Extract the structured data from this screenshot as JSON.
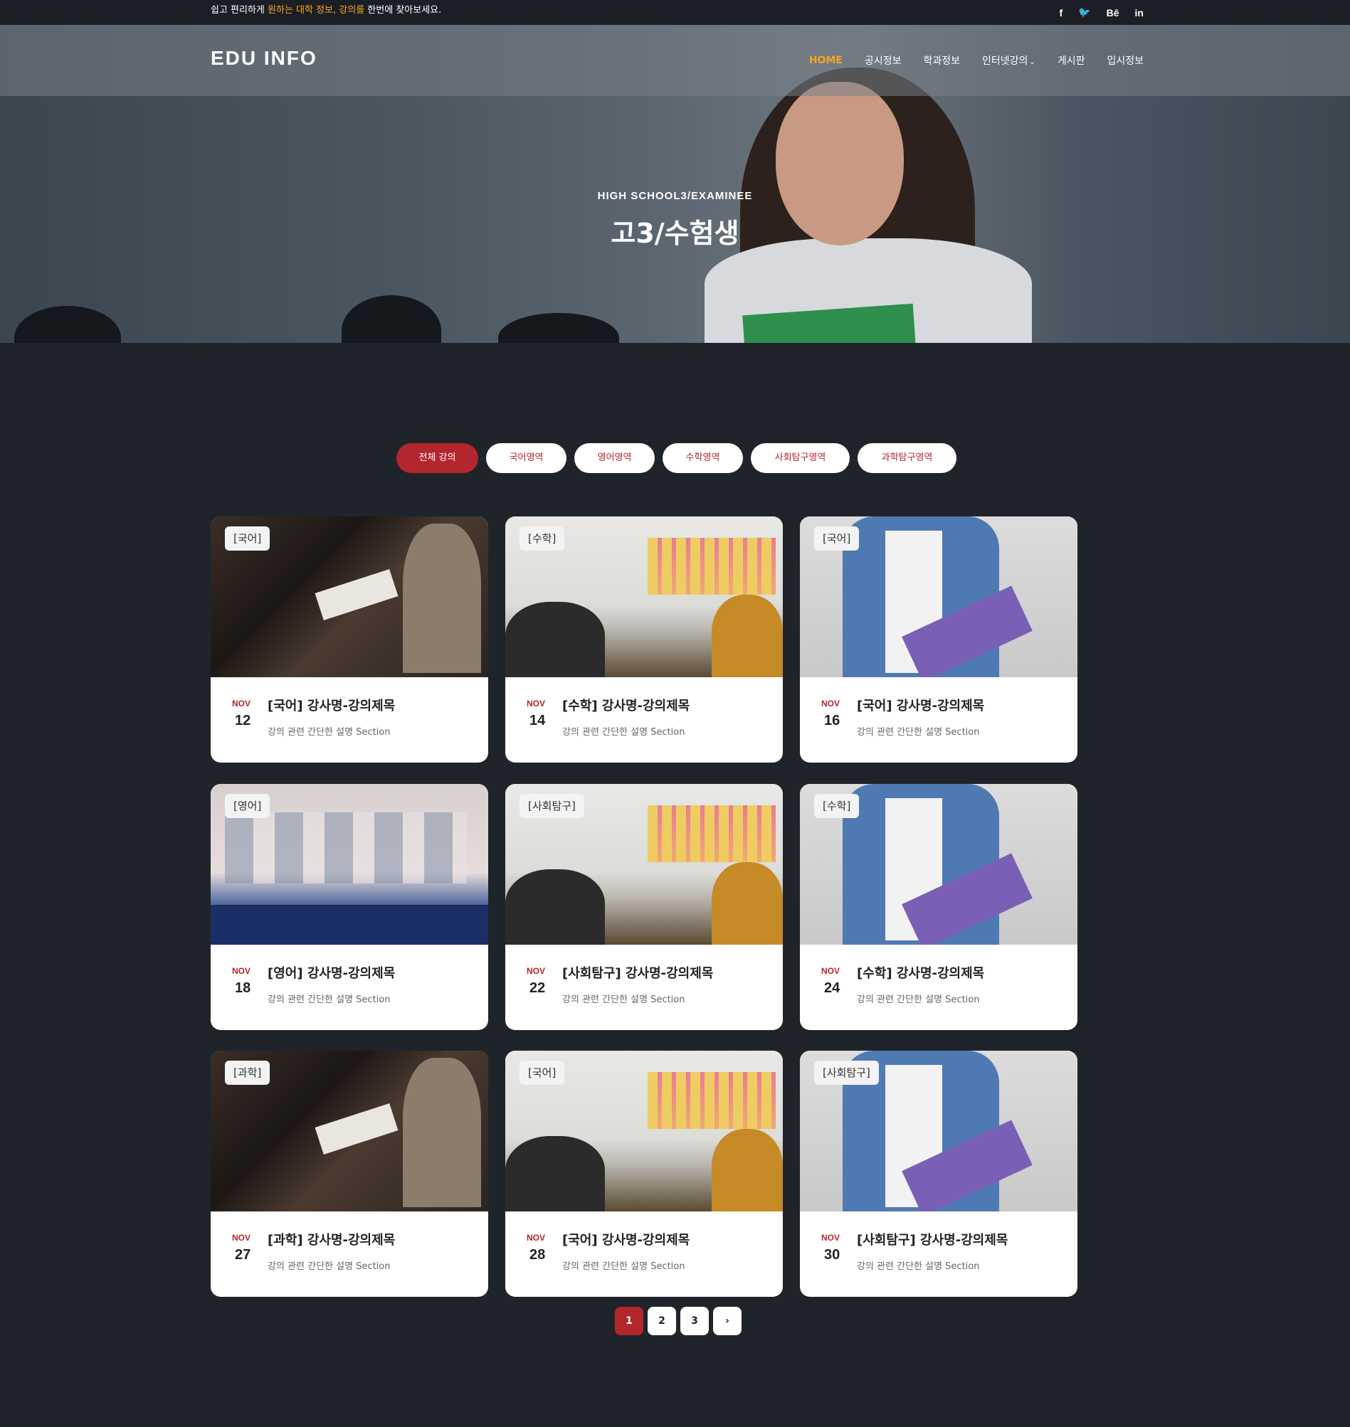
{
  "topbar": {
    "message_pre": "쉽고 편리하게 ",
    "message_hl": "원하는 대학 정보, 강의를",
    "message_post": " 한번에 찾아보세요.",
    "social": [
      "f",
      "🐦",
      "Bē",
      "in"
    ]
  },
  "header": {
    "logo": "EDU INFO",
    "menu": [
      "HOME",
      "공시정보",
      "학과정보",
      "인터넷강의",
      "게시판",
      "입시정보"
    ]
  },
  "hero": {
    "subtitle": "HIGH SCHOOL3/EXAMINEE",
    "title": "고3/수험생"
  },
  "filters": [
    "전체 강의",
    "국어영역",
    "영어영역",
    "수학영역",
    "사회탐구영역",
    "과학탐구영역"
  ],
  "cards": [
    {
      "tag": "[국어]",
      "month": "NOV",
      "day": "12",
      "title": "[국어] 강사명-강의제목",
      "desc": "강의 관련 간단한 설명 Section"
    },
    {
      "tag": "[수학]",
      "month": "NOV",
      "day": "14",
      "title": "[수학] 강사명-강의제목",
      "desc": "강의 관련 간단한 설명 Section"
    },
    {
      "tag": "[국어]",
      "month": "NOV",
      "day": "16",
      "title": "[국어] 강사명-강의제목",
      "desc": "강의 관련 간단한 설명 Section"
    },
    {
      "tag": "[영어]",
      "month": "NOV",
      "day": "18",
      "title": "[영어] 강사명-강의제목",
      "desc": "강의 관련 간단한 설명 Section"
    },
    {
      "tag": "[사회탐구]",
      "month": "NOV",
      "day": "22",
      "title": "[사회탐구] 강사명-강의제목",
      "desc": "강의 관련 간단한 설명 Section"
    },
    {
      "tag": "[수학]",
      "month": "NOV",
      "day": "24",
      "title": "[수학] 강사명-강의제목",
      "desc": "강의 관련 간단한 설명 Section"
    },
    {
      "tag": "[과학]",
      "month": "NOV",
      "day": "27",
      "title": "[과학] 강사명-강의제목",
      "desc": "강의 관련 간단한 설명 Section"
    },
    {
      "tag": "[국어]",
      "month": "NOV",
      "day": "28",
      "title": "[국어] 강사명-강의제목",
      "desc": "강의 관련 간단한 설명 Section"
    },
    {
      "tag": "[사회탐구]",
      "month": "NOV",
      "day": "30",
      "title": "[사회탐구] 강사명-강의제목",
      "desc": "강의 관련 간단한 설명 Section"
    }
  ],
  "pagination": [
    "1",
    "2",
    "3",
    "›"
  ],
  "colors": {
    "accent": "#b3262d",
    "menu_active": "#f5a623",
    "background": "#1f242b"
  }
}
